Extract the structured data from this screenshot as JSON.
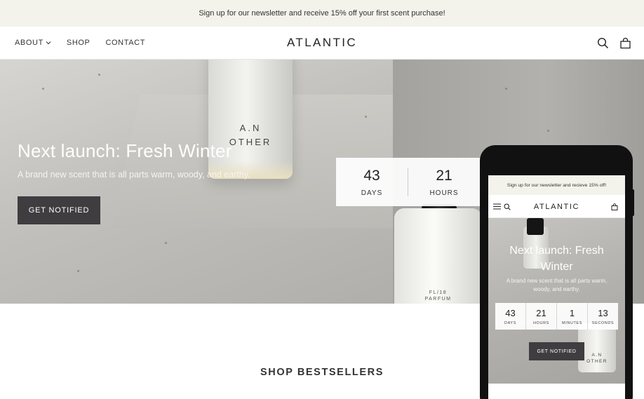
{
  "announcement": {
    "text": "Sign up for our newsletter and receive 15% off your first scent purchase!"
  },
  "header": {
    "nav": [
      {
        "label": "ABOUT",
        "has_dropdown": true
      },
      {
        "label": "SHOP"
      },
      {
        "label": "CONTACT"
      }
    ],
    "logo": "ATLANTIC",
    "icons": [
      "search-icon",
      "cart-icon"
    ]
  },
  "hero": {
    "title": "Next launch: Fresh Winter",
    "subtitle": "A brand new scent that is all parts warm, woody, and earthy.",
    "button_label": "GET NOTIFIED",
    "bottle1_label_line1": "A.N",
    "bottle1_label_line2": "OTHER",
    "bottle2_label_line1": "FL/18",
    "bottle2_label_line2": "PARFUM",
    "countdown": [
      {
        "value": "43",
        "label": "DAYS"
      },
      {
        "value": "21",
        "label": "HOURS"
      }
    ]
  },
  "section": {
    "title": "SHOP BESTSELLERS"
  },
  "mobile": {
    "announcement": "Sign up for our newsletter and recieve 15% off!",
    "logo": "ATLANTIC",
    "title": "Next launch: Fresh Winter",
    "subtitle": "A brand new scent that is all parts warm, woody, and earthy.",
    "button_label": "GET NOTIFIED",
    "bottle_label_line1": "A.N",
    "bottle_label_line2": "OTHER",
    "countdown": [
      {
        "value": "43",
        "label": "DAYS"
      },
      {
        "value": "21",
        "label": "HOURS"
      },
      {
        "value": "1",
        "label": "MINUTES"
      },
      {
        "value": "13",
        "label": "SECONDS"
      }
    ]
  },
  "colors": {
    "announcement_bg": "#f3f3ec",
    "button_bg": "#3f3d40",
    "text": "#2b2b2b"
  }
}
